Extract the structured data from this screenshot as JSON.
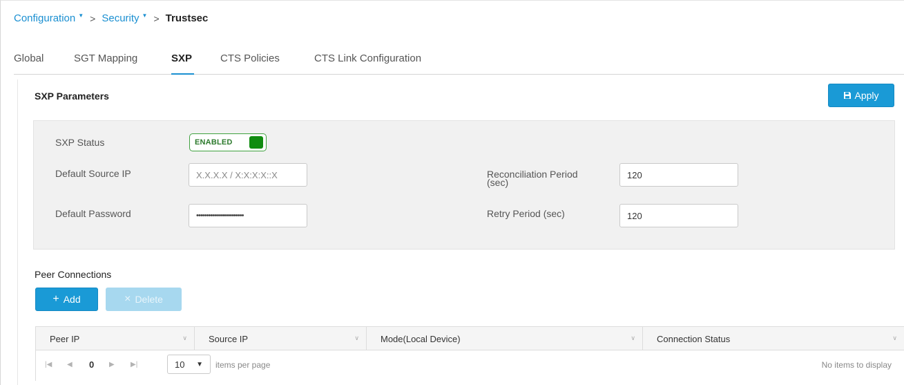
{
  "breadcrumb": {
    "items": [
      "Configuration",
      "Security"
    ],
    "separator": ">",
    "current": "Trustsec"
  },
  "tabs": [
    {
      "label": "Global",
      "active": false
    },
    {
      "label": "SGT Mapping",
      "active": false
    },
    {
      "label": "SXP",
      "active": true
    },
    {
      "label": "CTS Policies",
      "active": false
    },
    {
      "label": "CTS Link Configuration",
      "active": false
    }
  ],
  "sxp_parameters": {
    "title": "SXP Parameters",
    "apply_label": "Apply",
    "apply_icon": "save-icon",
    "status_label": "SXP Status",
    "status_toggle": "ENABLED",
    "source_ip_label": "Default Source IP",
    "source_ip_placeholder": "X.X.X.X / X:X:X:X::X",
    "source_ip_value": "",
    "password_label": "Default Password",
    "password_value": "••••••••••••••••••••••••",
    "reconciliation_label_line1": "Reconciliation Period",
    "reconciliation_label_line2": "(sec)",
    "reconciliation_value": "120",
    "retry_label": "Retry Period (sec)",
    "retry_value": "120"
  },
  "peer_connections": {
    "title": "Peer Connections",
    "add_label": "Add",
    "delete_label": "Delete",
    "columns": [
      "Peer IP",
      "Source IP",
      "Mode(Local Device)",
      "Connection Status"
    ],
    "page_number": "0",
    "page_size": "10",
    "items_per_page_label": "items per page",
    "empty_message": "No items to display"
  },
  "colors": {
    "accent": "#1a9ad6",
    "link": "#1a8fd1",
    "enabled_green": "#108c10"
  }
}
